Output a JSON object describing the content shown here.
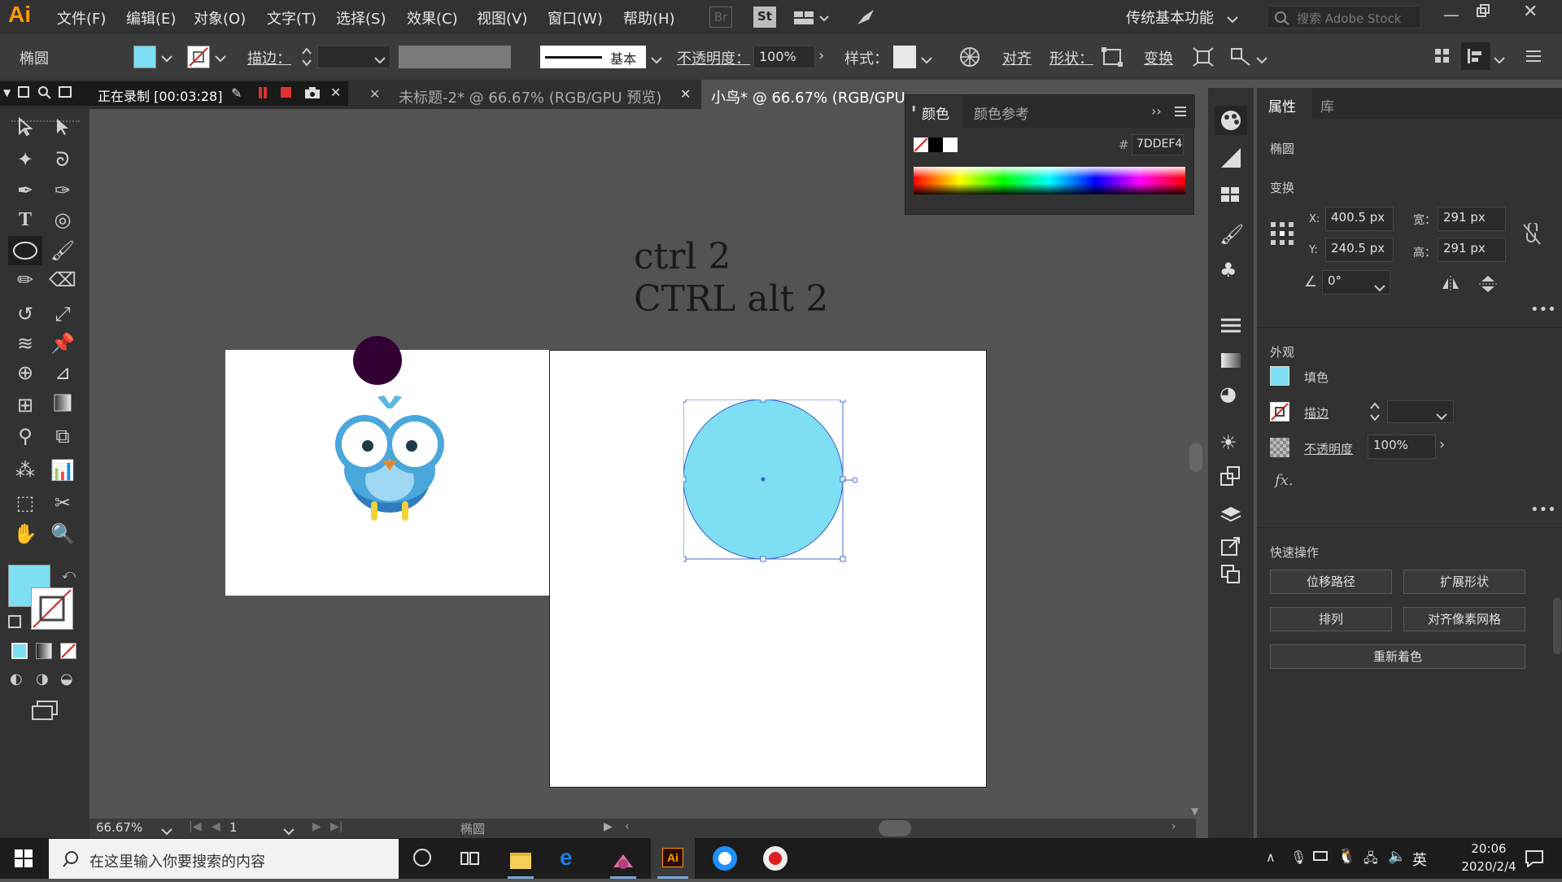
{
  "app": {
    "logo": "Ai"
  },
  "menu": {
    "items": [
      "文件(F)",
      "编辑(E)",
      "对象(O)",
      "文字(T)",
      "选择(S)",
      "效果(C)",
      "视图(V)",
      "窗口(W)",
      "帮助(H)"
    ],
    "bridge": "Br",
    "stock": "St",
    "workspace": "传统基本功能",
    "search_placeholder": "搜索 Adobe Stock"
  },
  "control": {
    "object_type": "椭圆",
    "stroke_label": "描边：",
    "stroke_profile": "基本",
    "opacity_label": "不透明度：",
    "opacity_value": "100%",
    "style_label": "样式：",
    "align_label": "对齐",
    "shape_label": "形状：",
    "transform_label": "变换",
    "fill_color": "#7DDEF4"
  },
  "recording": {
    "text": "正在录制 [00:03:28]"
  },
  "tabs": [
    {
      "label": "未标题-2* @ 66.67% (RGB/GPU 预览)"
    },
    {
      "label": "小鸟* @ 66.67% (RGB/GPU"
    }
  ],
  "color_panel": {
    "tab_color": "颜色",
    "tab_guide": "颜色参考",
    "hex_value": "7DDEF4"
  },
  "canvas": {
    "text_line1": "ctrl  2",
    "text_line2": "CTRL alt 2"
  },
  "status": {
    "zoom": "66.67%",
    "artboard_num": "1",
    "tool_name": "椭圆"
  },
  "properties": {
    "tab_props": "属性",
    "tab_library": "库",
    "object_type": "椭圆",
    "transform_title": "变换",
    "x_label": "X:",
    "x_value": "400.5 px",
    "y_label": "Y:",
    "y_value": "240.5 px",
    "w_label": "宽：",
    "w_value": "291 px",
    "h_label": "高：",
    "h_value": "291 px",
    "angle_value": "0°",
    "appearance_title": "外观",
    "fill_label": "填色",
    "stroke_label": "描边",
    "opacity_label": "不透明度",
    "opacity_value": "100%",
    "fx_label": "fx.",
    "quick_title": "快速操作",
    "btn_offset": "位移路径",
    "btn_expand": "扩展形状",
    "btn_arrange": "排列",
    "btn_pixel": "对齐像素网格",
    "btn_recolor": "重新着色"
  },
  "taskbar": {
    "search_placeholder": "在这里输入你要搜索的内容",
    "ime": "英",
    "time": "20:06",
    "date": "2020/2/4"
  }
}
